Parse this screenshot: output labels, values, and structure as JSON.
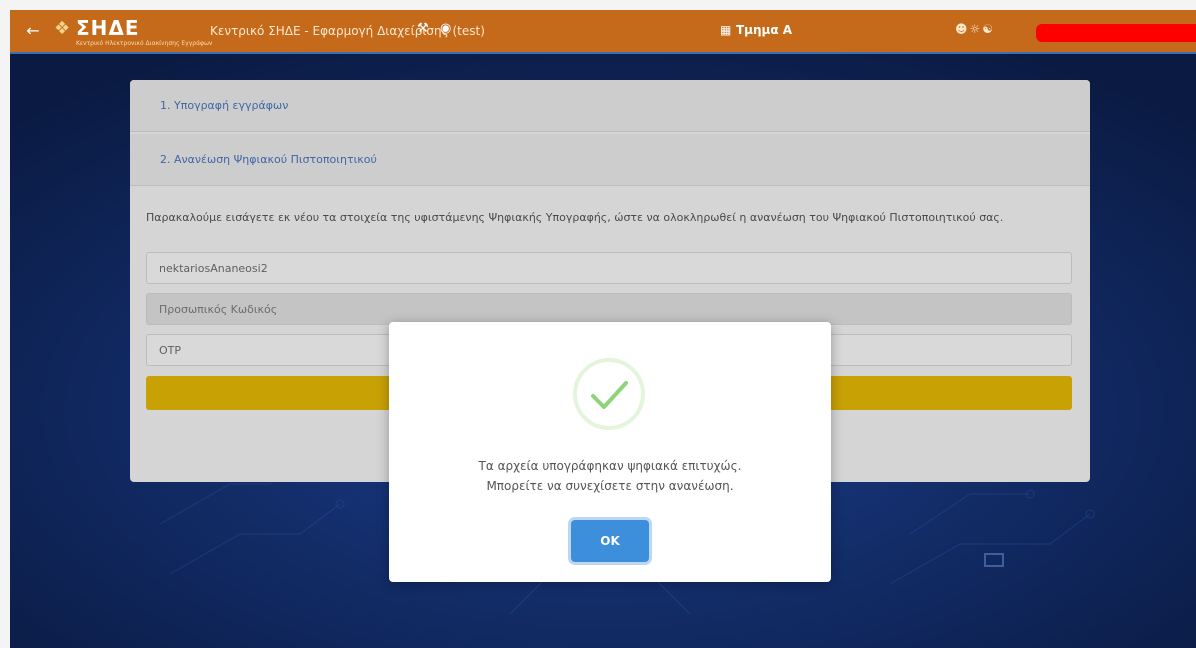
{
  "header": {
    "logo_text": "ΣΗΔΕ",
    "logo_subtitle": "Κεντρικό Ηλεκτρονικό Διακίνησης Εγγράφων",
    "app_title": "Κεντρικό ΣΗΔΕ - Εφαρμογή Διαχείρισης (test)",
    "department": "Τμημα Α"
  },
  "accordion": {
    "item1": "1. Υπογραφή εγγράφων",
    "item2": "2. Ανανέωση Ψηφιακού Πιστοποιητικού"
  },
  "form": {
    "instruction": "Παρακαλούμε εισάγετε εκ νέου τα στοιχεία της υφιστάμενης Ψηφιακής Υπογραφής, ώστε να ολοκληρωθεί η ανανέωση του Ψηφιακού Πιστοποιητικού σας.",
    "username_value": "nektariosAnaneosi2",
    "password_placeholder": "Προσωπικός Κωδικός",
    "otp_placeholder": "OTP"
  },
  "modal": {
    "line1": "Τα αρχεία υπογράφηκαν ψηφιακά επιτυχώς.",
    "line2": "Μπορείτε να συνεχίσετε στην ανανέωση.",
    "ok_label": "OK"
  },
  "colors": {
    "topbar": "#c56a1a",
    "accent_blue": "#3d8fdb",
    "success_green": "#8fd37a",
    "submit_yellow": "#c8a105"
  }
}
